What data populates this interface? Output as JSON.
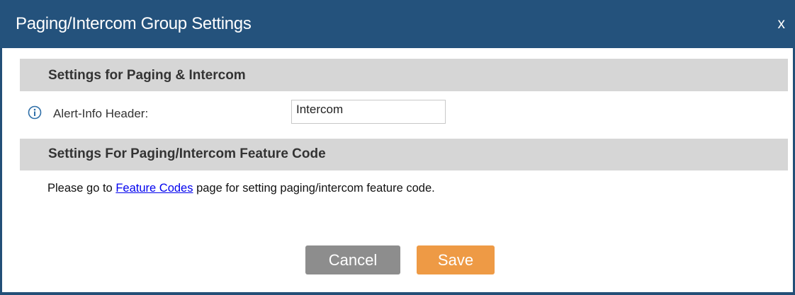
{
  "dialog": {
    "title": "Paging/Intercom Group Settings",
    "close_label": "x"
  },
  "sections": {
    "paging_intercom": {
      "header": "Settings for Paging & Intercom",
      "fields": {
        "alert_info_header": {
          "label": "Alert-Info Header:",
          "value": "Intercom",
          "help_icon": "info-icon"
        }
      }
    },
    "feature_code": {
      "header": "Settings For Paging/Intercom Feature Code",
      "note_prefix": "Please go to ",
      "note_link": "Feature Codes",
      "note_suffix": " page for setting paging/intercom feature code."
    }
  },
  "buttons": {
    "cancel": "Cancel",
    "save": "Save"
  },
  "colors": {
    "titlebar": "#24527c",
    "section_header_bg": "#d6d6d6",
    "cancel_button": "#8d8d8d",
    "save_button": "#ee9a45",
    "link": "#0000ee",
    "info_icon": "#2f6fa8"
  }
}
